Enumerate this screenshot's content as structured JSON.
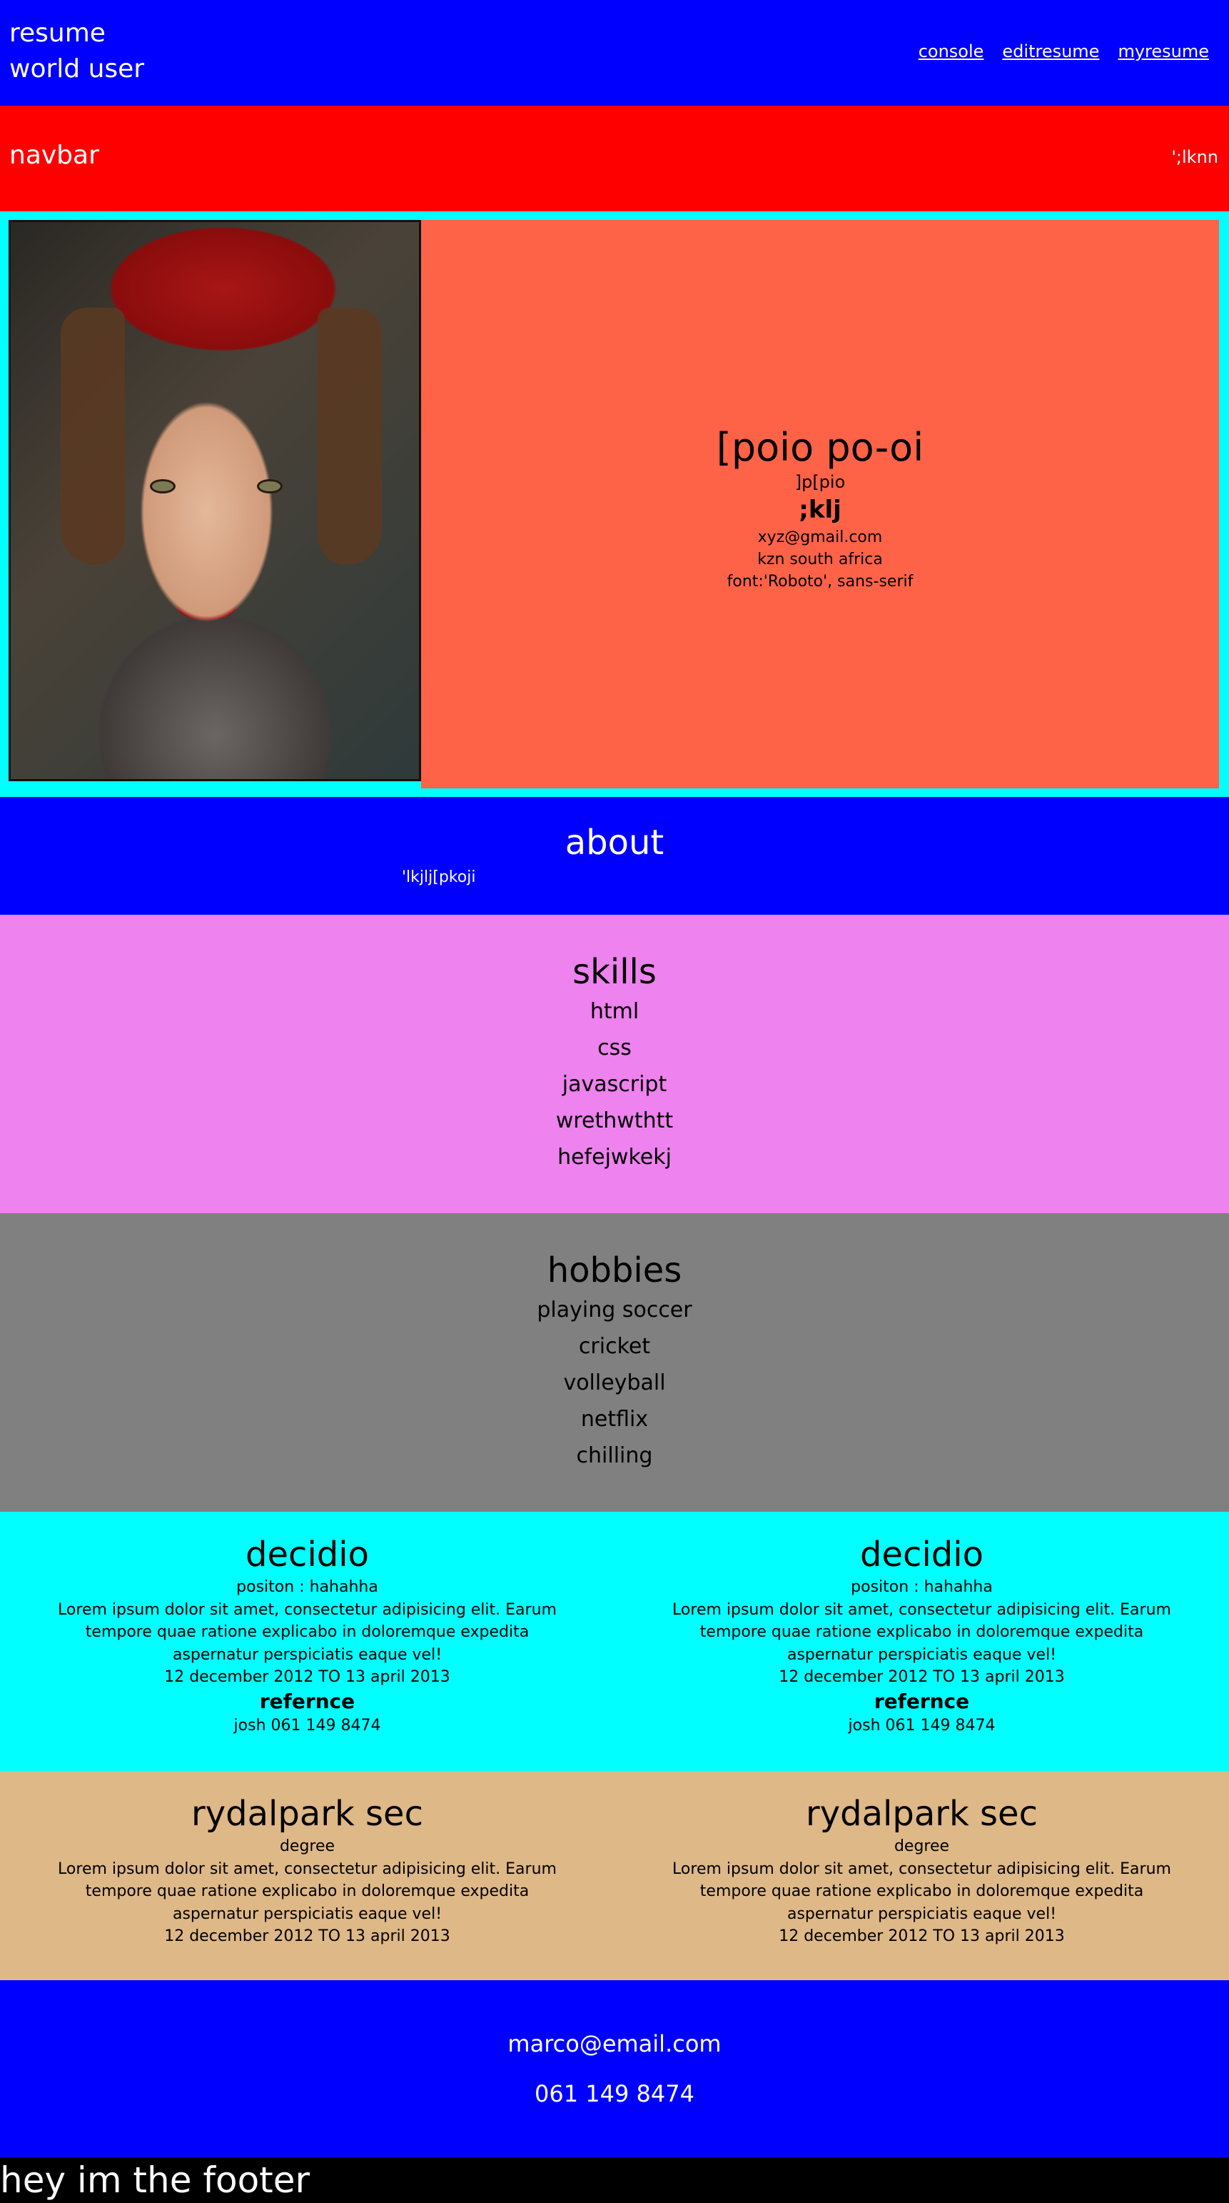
{
  "header": {
    "brand_line1": "resume",
    "brand_line2": "world user",
    "links": [
      "console",
      "editresume",
      "myresume"
    ]
  },
  "navbar": {
    "left": "navbar",
    "right": "';lknn"
  },
  "profile": {
    "name": "[poio po-oi",
    "subtitle": "]p[pio",
    "role": ";klj",
    "email": "xyz@gmail.com",
    "location": "kzn south africa",
    "font_note": "font:'Roboto', sans-serif"
  },
  "about": {
    "title": "about",
    "text": "'lkjlj[pkoji"
  },
  "skills": {
    "title": "skills",
    "items": [
      "html",
      "css",
      "javascript",
      "wrethwthtt",
      "hefejwkekj"
    ]
  },
  "hobbies": {
    "title": "hobbies",
    "items": [
      "playing soccer",
      "cricket",
      "volleyball",
      "netflix",
      "chilling"
    ]
  },
  "experience": [
    {
      "company": "decidio",
      "position": "positon : hahahha",
      "description": "Lorem ipsum dolor sit amet, consectetur adipisicing elit. Earum tempore quae ratione explicabo in doloremque expedita aspernatur perspiciatis eaque vel!",
      "dates": "12 december 2012 TO 13 april 2013",
      "ref_label": "refernce",
      "ref": "josh 061 149 8474"
    },
    {
      "company": "decidio",
      "position": "positon : hahahha",
      "description": "Lorem ipsum dolor sit amet, consectetur adipisicing elit. Earum tempore quae ratione explicabo in doloremque expedita aspernatur perspiciatis eaque vel!",
      "dates": "12 december 2012 TO 13 april 2013",
      "ref_label": "refernce",
      "ref": "josh 061 149 8474"
    }
  ],
  "education": [
    {
      "school": "rydalpark sec",
      "degree": "degree",
      "description": "Lorem ipsum dolor sit amet, consectetur adipisicing elit. Earum tempore quae ratione explicabo in doloremque expedita aspernatur perspiciatis eaque vel!",
      "dates": "12 december 2012 TO 13 april 2013"
    },
    {
      "school": "rydalpark sec",
      "degree": "degree",
      "description": "Lorem ipsum dolor sit amet, consectetur adipisicing elit. Earum tempore quae ratione explicabo in doloremque expedita aspernatur perspiciatis eaque vel!",
      "dates": "12 december 2012 TO 13 april 2013"
    }
  ],
  "contact": {
    "email": "marco@email.com",
    "phone": "061 149 8474"
  },
  "footer": {
    "text": "hey im the footer"
  },
  "colors": {
    "header_bg": "#0000ff",
    "navbar_bg": "#ff0000",
    "profile_bg": "#00ffff",
    "card_bg": "#ff6347",
    "skills_bg": "#ee82ee",
    "hobbies_bg": "#808080",
    "education_bg": "#deb887",
    "footer_bg": "#000000"
  }
}
